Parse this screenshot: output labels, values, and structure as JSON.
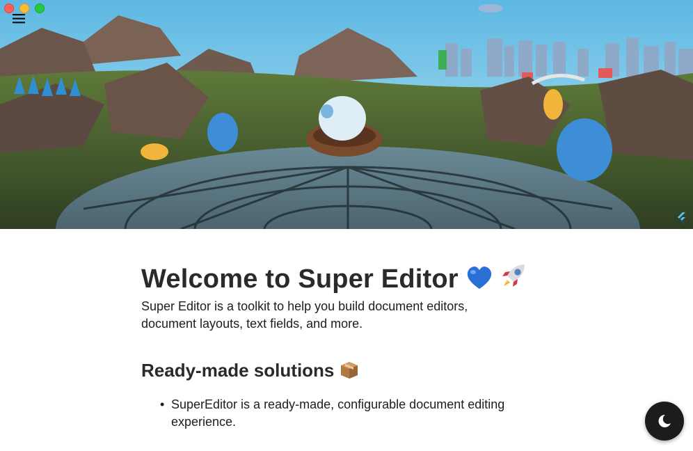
{
  "window": {
    "controls": [
      "close",
      "minimize",
      "zoom"
    ]
  },
  "header": {
    "image_subject": "3D landscape illustration with a bird nest on a glass dome",
    "menu_icon": "menu-icon",
    "brand_icon": "flutter-logo-icon"
  },
  "document": {
    "title": "Welcome to Super Editor",
    "title_emojis": [
      "blue-heart-icon",
      "rocket-icon"
    ],
    "intro": "Super Editor is a toolkit to help you build document editors, document layouts, text fields, and more.",
    "section_title": "Ready-made solutions",
    "section_emoji": "package-icon",
    "list_items": [
      "SuperEditor is a ready-made, configurable document editing experience."
    ]
  },
  "fab": {
    "icon": "dark-mode-moon-icon"
  },
  "colors": {
    "sky": "#72c4e6",
    "heading": "#2a2a2a",
    "text": "#1d1d1d",
    "fab": "#1c1c1c"
  }
}
